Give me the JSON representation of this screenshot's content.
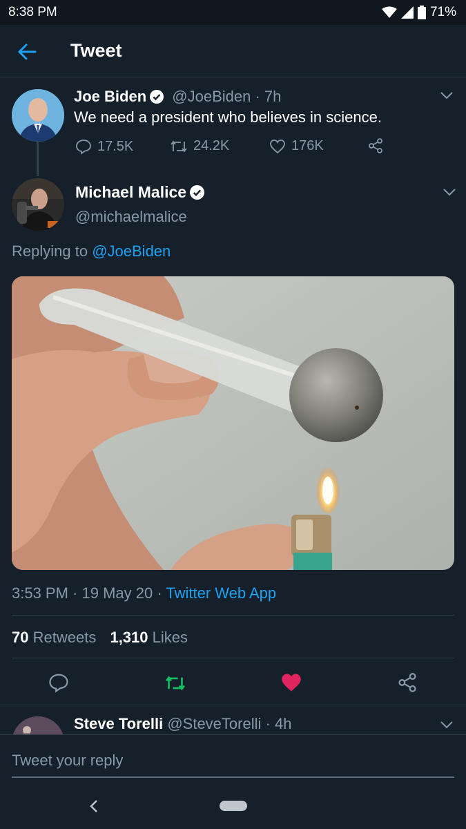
{
  "status": {
    "time": "8:38 PM",
    "battery": "71%"
  },
  "header": {
    "title": "Tweet"
  },
  "parent_tweet": {
    "name": "Joe Biden",
    "handle": "@JoeBiden",
    "age": "· 7h",
    "text": "We need a president who believes in science.",
    "replies": "17.5K",
    "retweets": "24.2K",
    "likes": "176K"
  },
  "main_tweet": {
    "name": "Michael Malice",
    "handle": "@michaelmalice",
    "replying_prefix": "Replying to",
    "replying_to": "@JoeBiden",
    "time": "3:53 PM · 19 May 20 ·",
    "source": "Twitter Web App",
    "retweet_count": "70",
    "retweet_label": "Retweets",
    "like_count": "1,310",
    "like_label": "Likes"
  },
  "reply_preview": {
    "name": "Steve Torelli",
    "handle": "@SteveTorelli",
    "age": "· 4h"
  },
  "composer": {
    "placeholder": "Tweet your reply"
  },
  "colors": {
    "background": "#15202b",
    "accent": "#1da1f2",
    "retweet": "#17bf63",
    "like": "#e0245e"
  }
}
